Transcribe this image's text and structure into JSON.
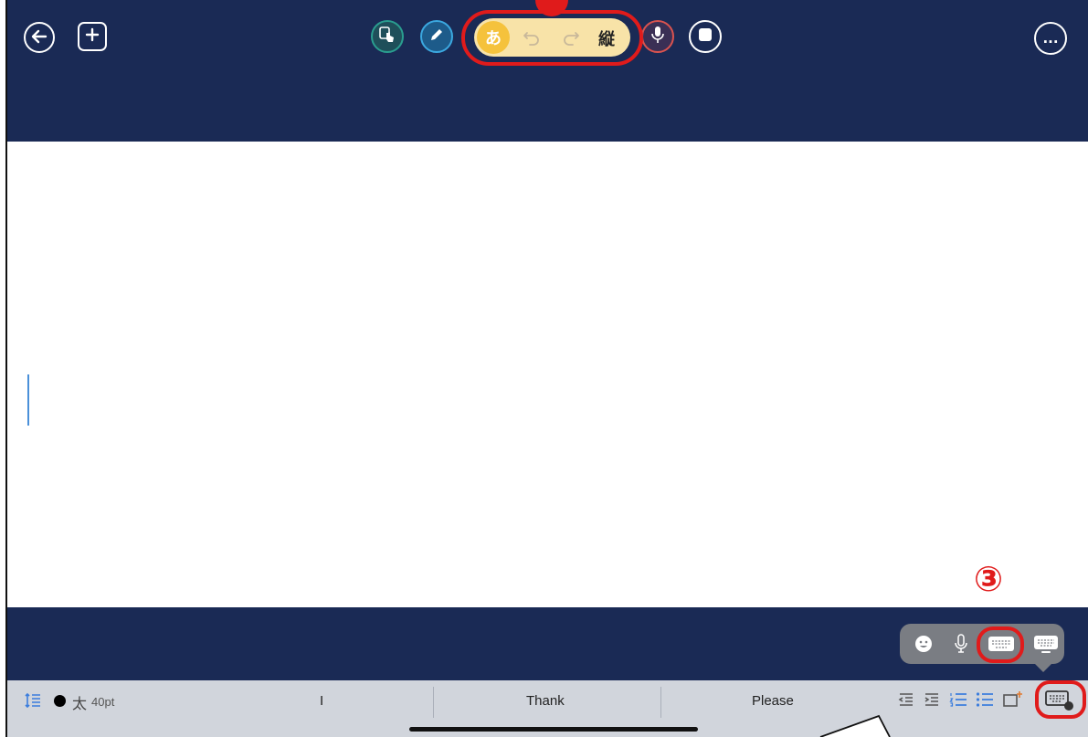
{
  "toolbar": {
    "left_buttons": [
      {
        "name": "back",
        "icon": "arrow-left-icon",
        "glyph": "←"
      },
      {
        "name": "add",
        "icon": "plus-icon",
        "glyph": "+"
      }
    ],
    "tools": [
      {
        "name": "hand-tool",
        "icon": "hand-pointer-icon",
        "color": "#2a9d8f"
      },
      {
        "name": "pen-tool",
        "icon": "pencil-icon",
        "color": "#3ba8e0"
      }
    ],
    "text_group": {
      "input_mode": "あ",
      "undo_icon": "undo-icon",
      "redo_icon": "redo-icon",
      "direction": "縦",
      "background": "#f8e3a8",
      "active_color": "#f5c23c"
    },
    "mic_icon": "microphone-icon",
    "stop_icon": "stop-icon",
    "more_label": "..."
  },
  "annotations": {
    "marker_3": "③",
    "highlight_color": "#e01b1b"
  },
  "format_bar": {
    "bold_label": "太",
    "size_label": "40pt"
  },
  "suggestions": [
    "I",
    "Thank",
    "Please"
  ],
  "input_popup": {
    "icons": [
      "emoji-icon",
      "microphone-icon",
      "keyboard-icon",
      "keyboard-icon"
    ]
  },
  "colors": {
    "navy": "#1a2a55",
    "keyboard_bar": "#d1d5dc",
    "accent_blue": "#3b7ddd"
  }
}
